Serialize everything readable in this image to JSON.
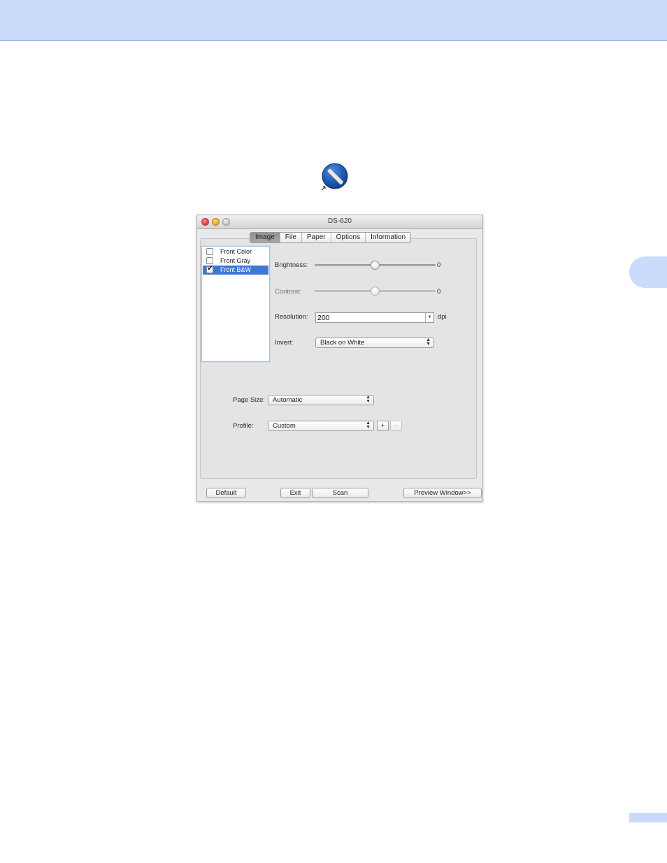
{
  "window": {
    "title": "DS-620"
  },
  "tabs": [
    {
      "label": "Image",
      "active": true
    },
    {
      "label": "File",
      "active": false
    },
    {
      "label": "Paper",
      "active": false
    },
    {
      "label": "Options",
      "active": false
    },
    {
      "label": "Information",
      "active": false
    }
  ],
  "image_list": [
    {
      "label": "Front Color",
      "checked": false,
      "selected": false
    },
    {
      "label": "Front Gray",
      "checked": false,
      "selected": false
    },
    {
      "label": "Front B&W",
      "checked": true,
      "selected": true
    }
  ],
  "brightness": {
    "label": "Brightness:",
    "value": "0",
    "level": 0.5
  },
  "contrast": {
    "label": "Contrast:",
    "value": "0",
    "level": 0.5,
    "enabled": false
  },
  "resolution": {
    "label": "Resolution:",
    "value": "200",
    "unit": "dpi"
  },
  "invert": {
    "label": "Invert:",
    "value": "Black on White"
  },
  "page_size": {
    "label": "Page Size:",
    "value": "Automatic"
  },
  "profile": {
    "label": "Profile:",
    "value": "Custom",
    "add_label": "+",
    "remove_label": "−"
  },
  "buttons": {
    "default": "Default",
    "exit": "Exit",
    "scan": "Scan",
    "preview": "Preview Window>>"
  },
  "colors": {
    "header_band": "#c9dcfc",
    "selection": "#3d78d6"
  }
}
